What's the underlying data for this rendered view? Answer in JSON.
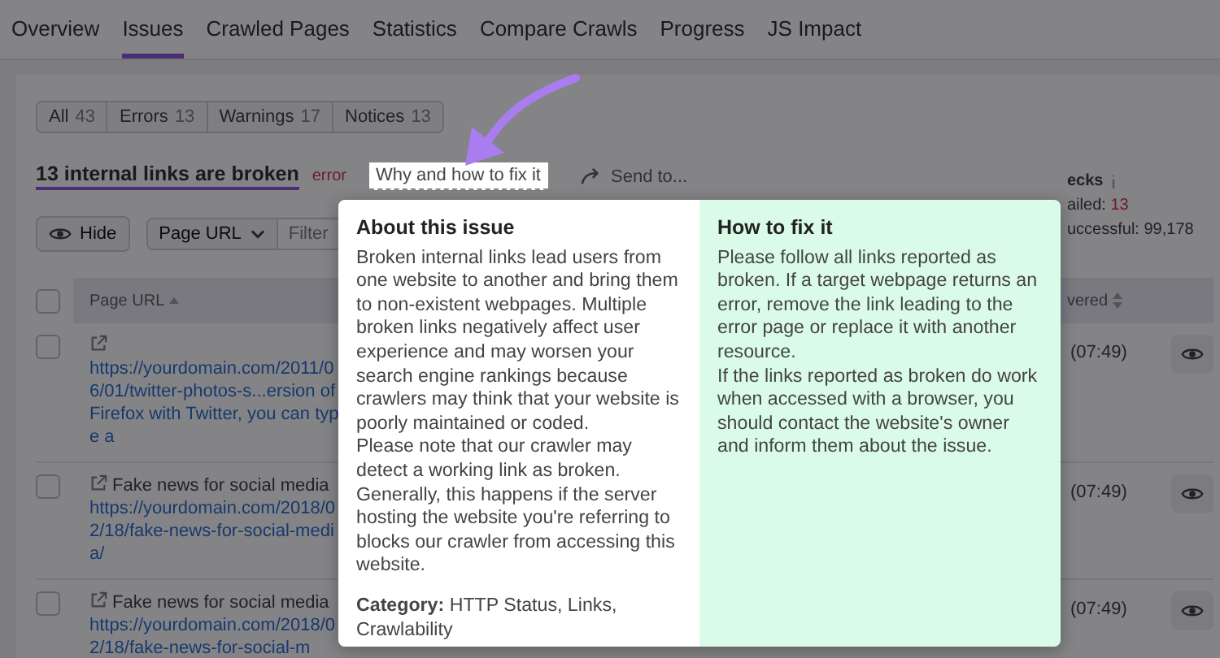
{
  "tabs": [
    {
      "label": "Overview",
      "selected": false
    },
    {
      "label": "Issues",
      "selected": true
    },
    {
      "label": "Crawled Pages",
      "selected": false
    },
    {
      "label": "Statistics",
      "selected": false
    },
    {
      "label": "Compare Crawls",
      "selected": false
    },
    {
      "label": "Progress",
      "selected": false
    },
    {
      "label": "JS Impact",
      "selected": false
    }
  ],
  "filters": [
    {
      "label": "All",
      "count": "43"
    },
    {
      "label": "Errors",
      "count": "13"
    },
    {
      "label": "Warnings",
      "count": "17"
    },
    {
      "label": "Notices",
      "count": "13"
    }
  ],
  "issue": {
    "title": "13 internal links are broken",
    "severity": "error",
    "help_link": "Why and how to fix it",
    "send_to": "Send to..."
  },
  "checks": {
    "title": "ecks",
    "failed_label": "ailed:",
    "failed": "13",
    "successful_label": "uccessful:",
    "successful": "99,178"
  },
  "toolbar": {
    "hide": "Hide",
    "column_select": "Page URL",
    "filter_placeholder": "Filter"
  },
  "table": {
    "select_all_checked": false,
    "columns": [
      {
        "label": "Page URL"
      },
      {
        "label": "vered"
      }
    ],
    "rows": [
      {
        "checked": false,
        "link": "https://yourdomain.com/2011/06/01/twitter-photos-s...ersion of Firefox with Twitter, you can type a",
        "time": "(07:49)"
      },
      {
        "checked": false,
        "title": "Fake news for social media",
        "link": "https://yourdomain.com/2018/02/18/fake-news-for-social-media/",
        "time": "(07:49)"
      },
      {
        "checked": false,
        "title": "Fake news for social media",
        "link": "https://yourdomain.com/2018/02/18/fake-news-for-social-m",
        "time": "(07:49)"
      }
    ]
  },
  "popup": {
    "about": {
      "title": "About this issue",
      "paragraphs": [
        "Broken internal links lead users from one website to another and bring them to non-existent webpages. Multiple broken links negatively affect user experience and may worsen your search engine rankings because crawlers may think that your website is poorly maintained or coded.",
        "Please note that our crawler may detect a working link as broken. Generally, this happens if the server hosting the website you're referring to blocks our crawler from accessing this website."
      ],
      "category": "**Category:** HTTP Status, Links, Crawlability"
    },
    "fix": {
      "title": "How to fix it",
      "paragraphs": [
        "Please follow all links reported as broken. If a target webpage returns an error, remove the link leading to the error page or replace it with another resource.",
        "If the links reported as broken do work when accessed with a browser, you should contact the website's owner and inform them about the issue."
      ]
    }
  }
}
